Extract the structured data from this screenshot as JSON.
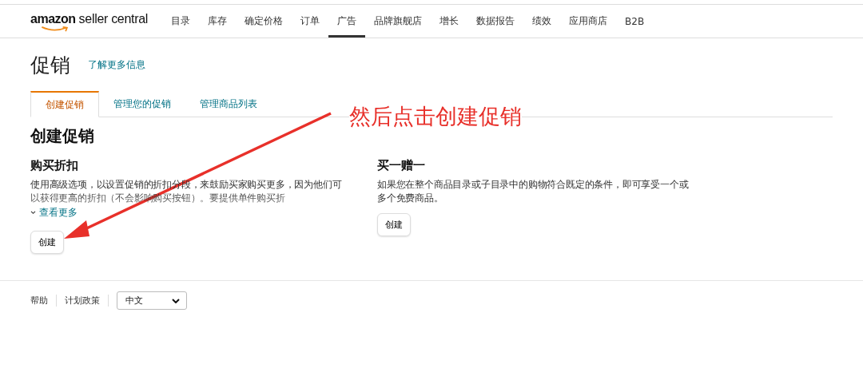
{
  "header": {
    "logo": {
      "brand": "amazon",
      "product": "seller central"
    },
    "nav": [
      {
        "label": "目录",
        "selected": false
      },
      {
        "label": "库存",
        "selected": false
      },
      {
        "label": "确定价格",
        "selected": false
      },
      {
        "label": "订单",
        "selected": false
      },
      {
        "label": "广告",
        "selected": true
      },
      {
        "label": "品牌旗舰店",
        "selected": false
      },
      {
        "label": "增长",
        "selected": false
      },
      {
        "label": "数据报告",
        "selected": false
      },
      {
        "label": "绩效",
        "selected": false
      },
      {
        "label": "应用商店",
        "selected": false
      },
      {
        "label": "B2B",
        "selected": false
      }
    ]
  },
  "page": {
    "title": "促销",
    "learn_more": "了解更多信息",
    "tabs": [
      {
        "label": "创建促销",
        "selected": true
      },
      {
        "label": "管理您的促销",
        "selected": false
      },
      {
        "label": "管理商品列表",
        "selected": false
      }
    ],
    "heading": "创建促销",
    "promotions": [
      {
        "title": "购买折扣",
        "description": "使用高级选项，以设置促销的折扣分段，来鼓励买家购买更多，因为他们可以获得更高的折扣（不会影响购买按钮）。要提供单件购买折",
        "truncated": true,
        "see_more": "查看更多",
        "button": "创建"
      },
      {
        "title": "买一赠一",
        "description": "如果您在整个商品目录或子目录中的购物符合既定的条件，即可享受一个或多个免费商品。",
        "truncated": false,
        "button": "创建"
      }
    ]
  },
  "annotation": {
    "text": "然后点击创建促销"
  },
  "footer": {
    "links": [
      "帮助",
      "计划政策"
    ],
    "language": {
      "value": "中文"
    }
  }
}
